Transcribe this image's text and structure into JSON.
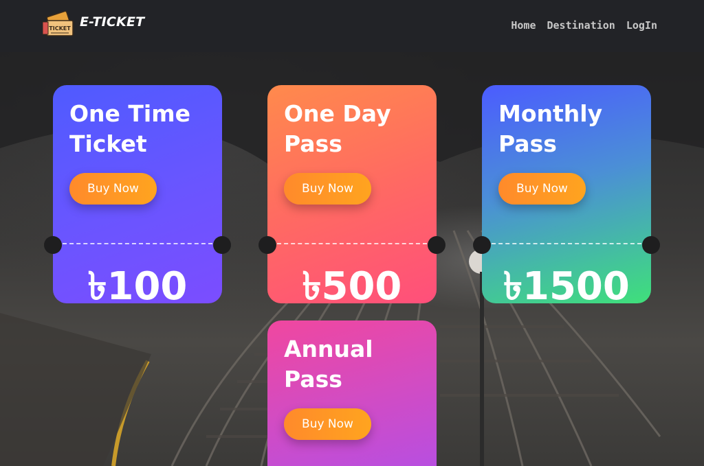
{
  "navbar": {
    "brand": "E-TICKET",
    "logo_icon_text": "TICKET",
    "links": [
      "Home",
      "Destination",
      "LogIn"
    ]
  },
  "cards": [
    {
      "title": "One Time Ticket",
      "button": "Buy Now",
      "price": "৳100",
      "gradient": [
        "#4f5bff",
        "#7b4dff"
      ]
    },
    {
      "title": "One Day Pass",
      "button": "Buy Now",
      "price": "৳500",
      "gradient": [
        "#ff8a4c",
        "#ff4f7b"
      ]
    },
    {
      "title": "Monthly Pass",
      "button": "Buy Now",
      "price": "৳1500",
      "gradient": [
        "#4b63ff",
        "#3fe07a"
      ]
    },
    {
      "title": "Annual Pass",
      "button": "Buy Now",
      "gradient": [
        "#f0479f",
        "#b84ee0"
      ]
    }
  ],
  "colors": {
    "navbar_bg": "#222327",
    "button_orange": "#ff9a25",
    "text": "#ffffff"
  }
}
